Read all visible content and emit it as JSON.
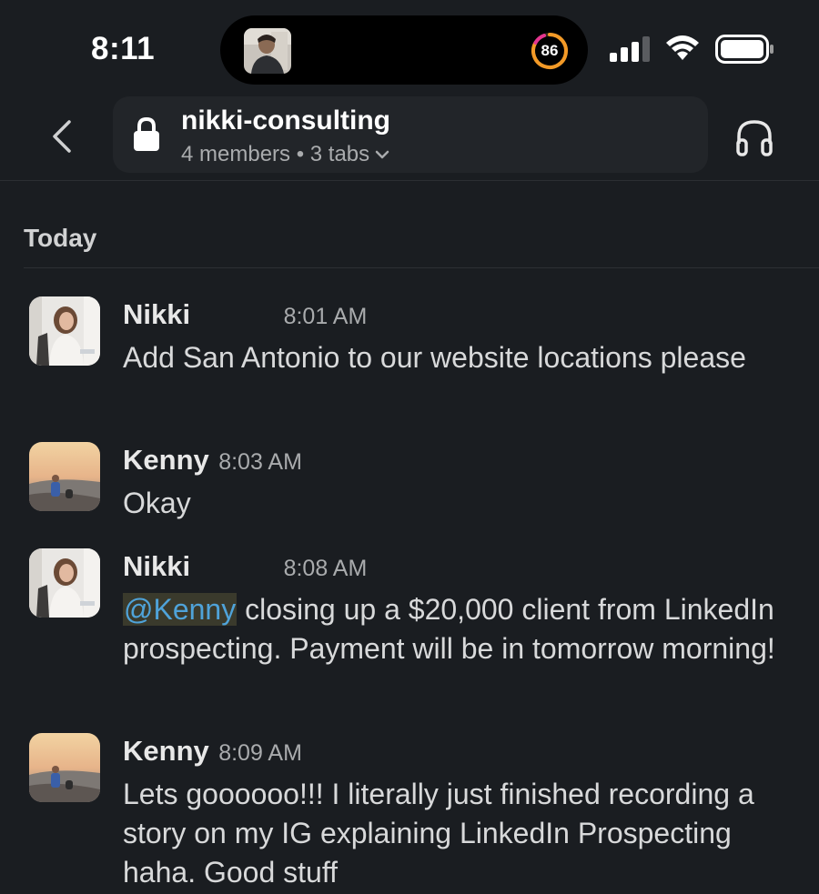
{
  "status_bar": {
    "time": "8:11",
    "activity_ring_value": "86",
    "icons": [
      "signal-bars-icon",
      "wifi-icon",
      "battery-icon"
    ]
  },
  "header": {
    "channel_name": "nikki-consulting",
    "channel_meta": "4 members • 3 tabs",
    "icons": [
      "back-chevron-icon",
      "lock-icon",
      "chevron-down-icon",
      "headphones-icon"
    ]
  },
  "day_divider": "Today",
  "messages": [
    {
      "sender": "Nikki",
      "time": "8:01 AM",
      "text": "Add San Antonio to our website locations please"
    },
    {
      "sender": "Kenny",
      "time": "8:03 AM",
      "text": "Okay"
    },
    {
      "sender": "Nikki",
      "time": "8:08 AM",
      "mention": "@Kenny",
      "text": " closing up a $20,000 client from LinkedIn prospecting. Payment will be in tomorrow morning!"
    },
    {
      "sender": "Kenny",
      "time": "8:09 AM",
      "text": "Lets goooooo!!! I literally just finished recording a story on my IG explaining LinkedIn Prospecting haha. Good stuff"
    }
  ],
  "colors": {
    "background": "#1a1d21",
    "mention_text": "#4fa3d9",
    "mention_bg": "#3a3a2c",
    "ring_orange": "#f39a27",
    "ring_pink": "#e5358f"
  }
}
